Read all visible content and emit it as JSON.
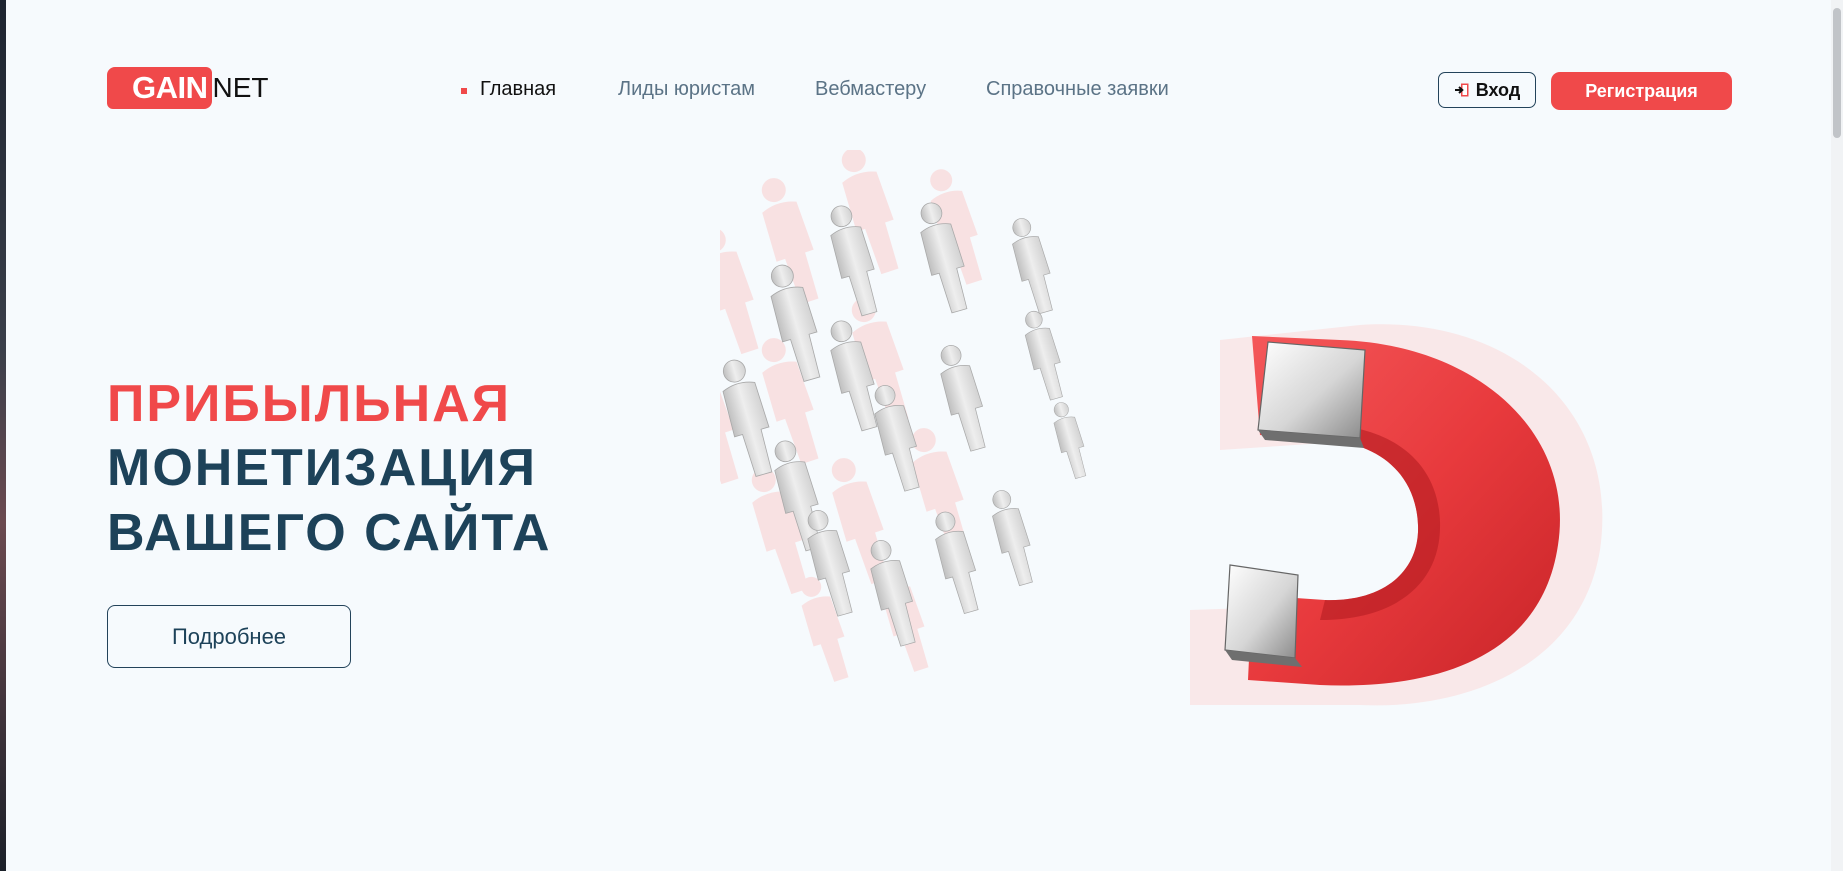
{
  "header": {
    "logo": {
      "part1": "GAIN",
      "part2": "NET"
    },
    "nav": [
      {
        "label": "Главная",
        "active": true
      },
      {
        "label": "Лиды юристам",
        "active": false
      },
      {
        "label": "Вебмастеру",
        "active": false
      },
      {
        "label": "Справочные заявки",
        "active": false
      }
    ],
    "login_label": "Вход",
    "register_label": "Регистрация",
    "login_icon": "login-door-icon"
  },
  "hero": {
    "line1": "ПРИБЫЛЬНАЯ",
    "line2": "МОНЕТИЗАЦИЯ",
    "line3": "ВАШЕГО САЙТА",
    "more_label": "Подробнее"
  },
  "colors": {
    "accent": "#f0494a",
    "dark": "#1d4259",
    "background": "#f6fafd"
  }
}
